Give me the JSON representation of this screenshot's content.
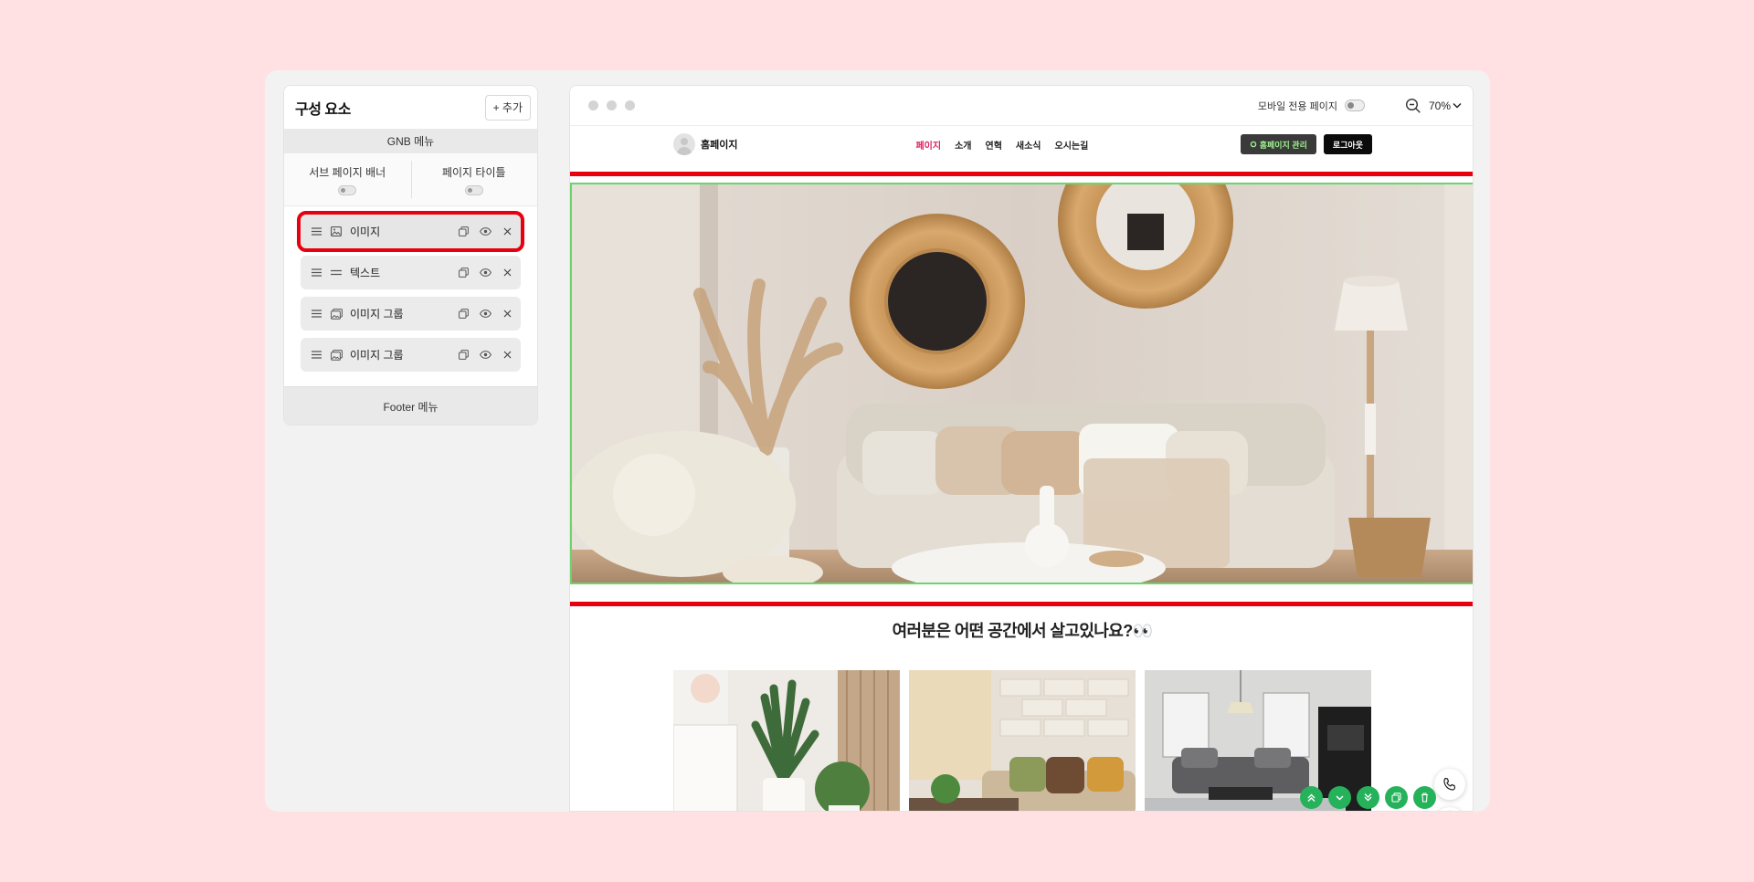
{
  "panel": {
    "title": "구성 요소",
    "add_label": "+ 추가",
    "gnb_label": "GNB 메뉴",
    "toggles": [
      {
        "label": "서브 페이지 배너"
      },
      {
        "label": "페이지 타이틀"
      }
    ],
    "components": [
      {
        "label": "이미지",
        "icon": "image-icon",
        "selected": true
      },
      {
        "label": "텍스트",
        "icon": "text-lines-icon",
        "selected": false
      },
      {
        "label": "이미지 그룹",
        "icon": "image-group-icon",
        "selected": false
      },
      {
        "label": "이미지 그룹",
        "icon": "image-group-icon",
        "selected": false
      }
    ],
    "footer_label": "Footer 메뉴"
  },
  "toolbar": {
    "mobile_label": "모바일 전용 페이지",
    "zoom": "70%"
  },
  "site": {
    "logo_text": "홈페이지",
    "nav": [
      {
        "label": "페이지",
        "active": true
      },
      {
        "label": "소개",
        "active": false
      },
      {
        "label": "연혁",
        "active": false
      },
      {
        "label": "새소식",
        "active": false
      },
      {
        "label": "오시는길",
        "active": false
      }
    ],
    "manage_label": "홈페이지 관리",
    "logout_label": "로그아웃",
    "section_title": "여러분은 어떤 공간에서 살고있나요?👀"
  },
  "colors": {
    "highlight": "#e8000f",
    "accent_green": "#25b25a",
    "nav_active": "#e0245e",
    "background": "#ffe1e3"
  }
}
